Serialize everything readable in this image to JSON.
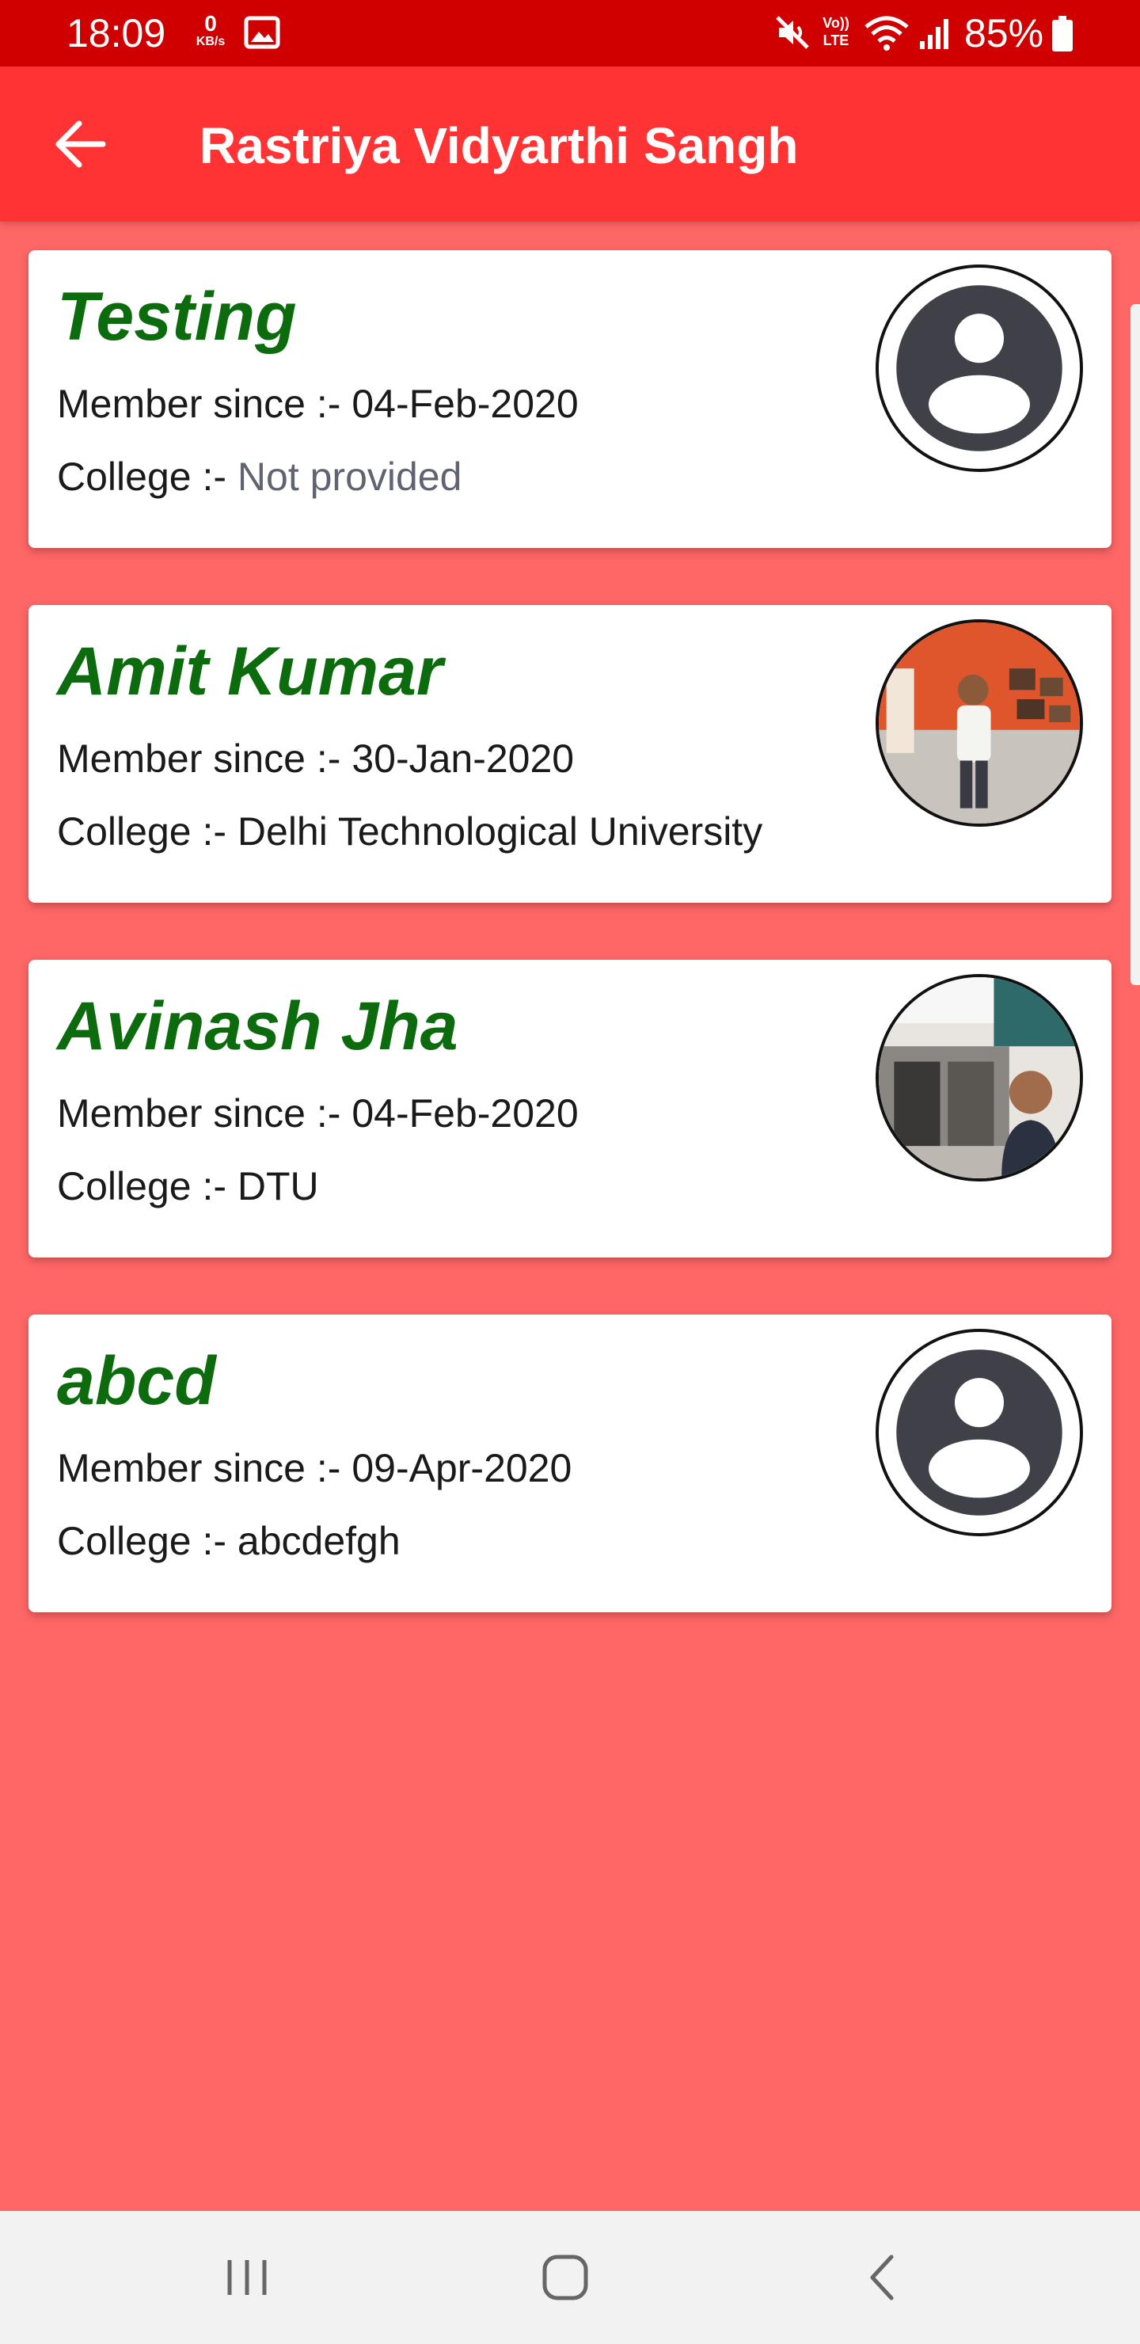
{
  "status_bar": {
    "time": "18:09",
    "net_speed_value": "0",
    "net_speed_unit": "KB/s",
    "volte_line1": "Vo))",
    "volte_line2": "LTE",
    "battery": "85%",
    "icons": [
      "image-icon",
      "mute-icon",
      "wifi-icon",
      "signal-icon",
      "battery-icon"
    ]
  },
  "app_bar": {
    "back_icon": "arrow-left-icon",
    "title": "Rastriya Vidyarthi Sangh"
  },
  "members": [
    {
      "name": "Testing",
      "member_since_label": "Member since :-",
      "member_since": "04-Feb-2020",
      "college_label": "College :-",
      "college": "Not provided",
      "avatar": "default-avatar"
    },
    {
      "name": "Amit Kumar",
      "member_since_label": "Member since :-",
      "member_since": "30-Jan-2020",
      "college_label": "College :-",
      "college": "Delhi Technological University",
      "avatar": "photo"
    },
    {
      "name": "Avinash Jha",
      "member_since_label": "Member since :-",
      "member_since": "04-Feb-2020",
      "college_label": "College :-",
      "college": "DTU",
      "avatar": "photo"
    },
    {
      "name": "abcd",
      "member_since_label": "Member since :-",
      "member_since": "09-Apr-2020",
      "college_label": "College :-",
      "college": "abcdefgh",
      "avatar": "default-avatar"
    }
  ],
  "nav_bar": {
    "icons": [
      "recent-apps-icon",
      "home-icon",
      "back-icon"
    ]
  },
  "colors": {
    "status_bar": "#d10000",
    "app_bar": "#ff3333",
    "background": "#ff6666",
    "name_text": "#0c6b0c",
    "card": "#ffffff"
  }
}
